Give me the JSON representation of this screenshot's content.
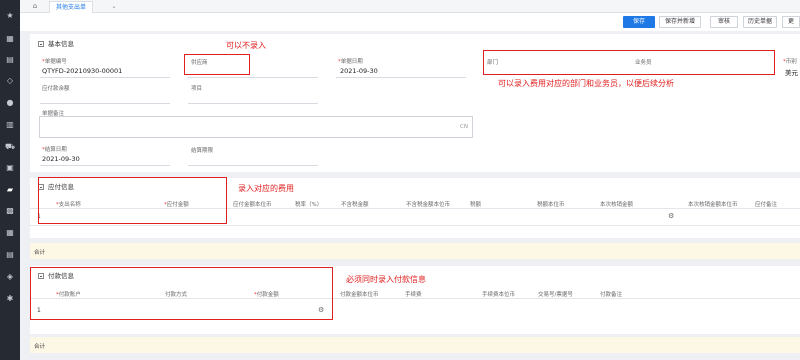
{
  "sidebar": {
    "icons": [
      "star-icon",
      "calculator-icon",
      "archive-icon",
      "diamond-icon",
      "coin-icon",
      "chart-icon",
      "cart-icon",
      "truck-icon",
      "money-icon",
      "package-icon",
      "calendar-icon",
      "list-icon",
      "box-icon",
      "layers-icon",
      "settings-icon"
    ]
  },
  "tabbar": {
    "home_glyph": "⌂",
    "active_tab": "其他支出单",
    "more_glyph": "⌄"
  },
  "toolbar": {
    "save": "保存",
    "save_new": "保存并新增",
    "audit": "审核",
    "history": "历史单据",
    "more": "更"
  },
  "basic": {
    "title": "基本信息",
    "doc_no_label": "单据编号",
    "doc_no_value": "QTYFD-20210930-00001",
    "supplier_label": "供应商",
    "date_label": "单据日期",
    "date_value": "2021-09-30",
    "dept_label": "部门",
    "salesman_label": "业务员",
    "currency_label": "币别",
    "currency_value": "美元",
    "payable_balance_label": "应付款余额",
    "project_label": "项目",
    "remark_label": "单据备注",
    "remark_lang": "CN",
    "settle_date_label": "结算日期",
    "settle_date_value": "2021-09-30",
    "settle_period_label": "结算期限"
  },
  "payable": {
    "title": "应付信息",
    "columns": [
      "支出名称",
      "应付金额",
      "应付金额本位币",
      "税率（%）",
      "不含税金额",
      "不含税金额本位币",
      "税额",
      "税额本位币",
      "本次核销金额",
      "本次核销金额本位币",
      "应付备注"
    ],
    "required": [
      true,
      true,
      false,
      false,
      false,
      false,
      false,
      false,
      false,
      false,
      false
    ],
    "rows": [
      {
        "num": "1"
      }
    ],
    "gear_glyph": "⚙",
    "total_label": "合计"
  },
  "payment": {
    "title": "付款信息",
    "columns": [
      "付款账户",
      "付款方式",
      "付款金额",
      "付款金额本位币",
      "手续费",
      "手续费本位币",
      "交易号/票据号",
      "付款备注"
    ],
    "required": [
      true,
      false,
      true,
      false,
      false,
      false,
      false,
      false
    ],
    "rows": [
      {
        "num": "1"
      }
    ],
    "gear_glyph": "⚙",
    "total_label": "合计"
  },
  "annotations": {
    "supplier_optional": "可以不录入",
    "dept_hint": "可以录入费用对应的部门和业务员，以便后续分析",
    "payable_hint": "录入对应的费用",
    "payment_hint": "必须同时录入付款信息"
  }
}
